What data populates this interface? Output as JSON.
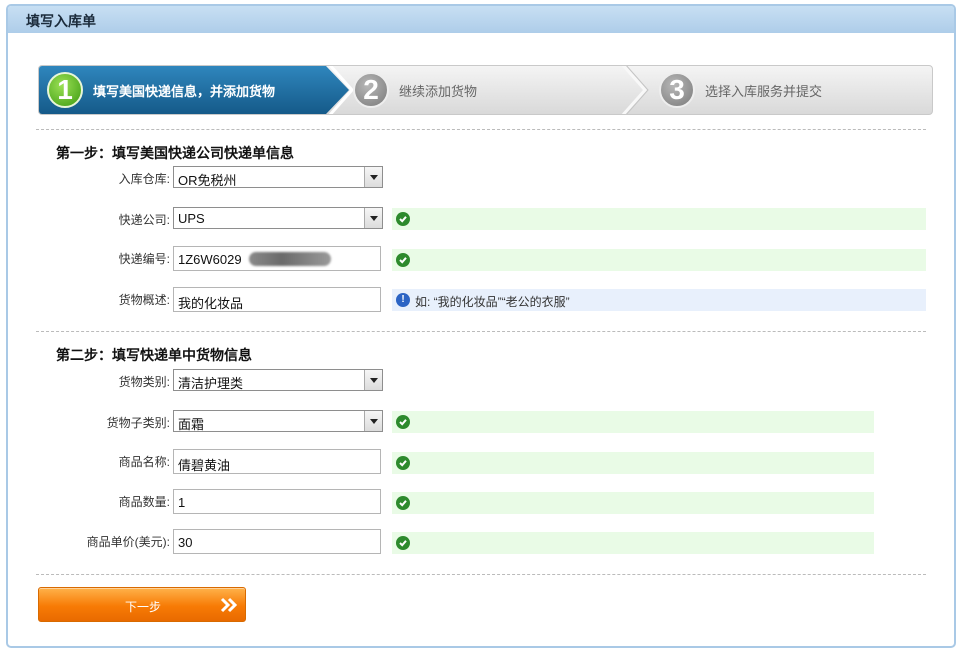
{
  "panel": {
    "title": "填写入库单"
  },
  "steps": [
    {
      "num": "1",
      "label": "填写美国快递信息，并添加货物",
      "active": true
    },
    {
      "num": "2",
      "label": "继续添加货物",
      "active": false
    },
    {
      "num": "3",
      "label": "选择入库服务并提交",
      "active": false
    }
  ],
  "section1": {
    "title": "第一步：填写美国快递公司快递单信息",
    "warehouse": {
      "label": "入库仓库:",
      "value": "OR免税州"
    },
    "courier": {
      "label": "快递公司:",
      "value": "UPS"
    },
    "tracking": {
      "label": "快递编号:",
      "value": "1Z6W6029"
    },
    "description": {
      "label": "货物概述:",
      "value": "我的化妆品",
      "hint": "如: “我的化妆品”“老公的衣服”"
    }
  },
  "section2": {
    "title": "第二步：填写快递单中货物信息",
    "category": {
      "label": "货物类别:",
      "value": "清洁护理类"
    },
    "subcategory": {
      "label": "货物子类别:",
      "value": "面霜"
    },
    "product_name": {
      "label": "商品名称:",
      "value": "倩碧黄油"
    },
    "quantity": {
      "label": "商品数量:",
      "value": "1"
    },
    "unit_price": {
      "label": "商品单价(美元):",
      "value": "30"
    }
  },
  "next_button": {
    "label": "下一步"
  },
  "colors": {
    "accent_blue": "#1e6a9c",
    "success_bg": "#e9fbe6",
    "info_bg": "#e8f0fc",
    "button_orange": "#f77b05"
  },
  "icons": {
    "valid": "check-circle-icon",
    "info": "info-circle-icon",
    "next": "double-chevron-right-icon"
  }
}
